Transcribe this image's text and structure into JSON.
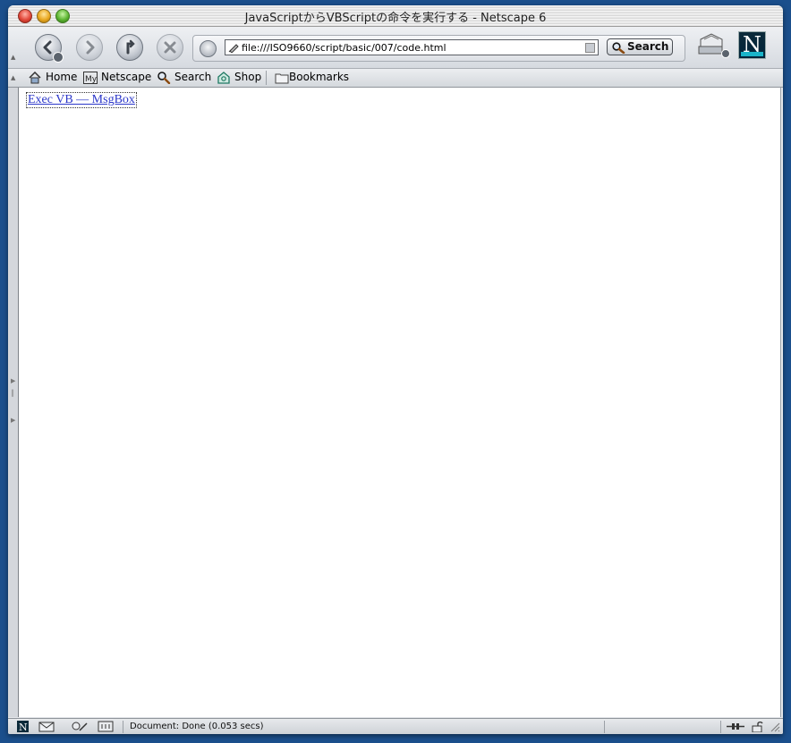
{
  "window": {
    "title": "JavaScriptからVBScriptの命令を実行する - Netscape 6"
  },
  "toolbar": {
    "url": "file:///ISO9660/script/basic/007/code.html",
    "search_label": "Search"
  },
  "bookmarks": {
    "items": [
      {
        "label": "Home",
        "icon": "home-icon"
      },
      {
        "label": "Netscape",
        "icon": "my-netscape-icon"
      },
      {
        "label": "Search",
        "icon": "search-icon"
      },
      {
        "label": "Shop",
        "icon": "shop-icon"
      },
      {
        "label": "Bookmarks",
        "icon": "folder-icon"
      }
    ]
  },
  "page": {
    "link_text": "Exec VB — MsgBox"
  },
  "status": {
    "text": "Document: Done (0.053 secs)"
  },
  "colors": {
    "link": "#2c37c9",
    "desktop": "#1b4f8c"
  }
}
